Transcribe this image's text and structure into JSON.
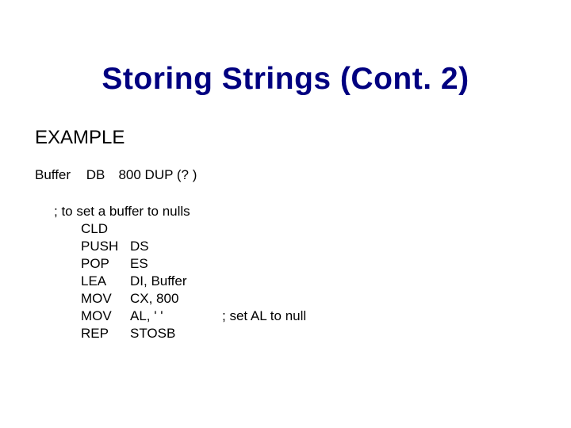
{
  "title": "Storing Strings (Cont. 2)",
  "subhead": "EXAMPLE",
  "decl": {
    "label": "Buffer",
    "directive": "DB",
    "value": "800 DUP (? )"
  },
  "code": {
    "comment_header": "; to set a buffer to nulls",
    "lines": [
      {
        "mnemonic": "CLD",
        "args": "",
        "comment": ""
      },
      {
        "mnemonic": "PUSH",
        "args": "DS",
        "comment": ""
      },
      {
        "mnemonic": "POP",
        "args": "ES",
        "comment": ""
      },
      {
        "mnemonic": "LEA",
        "args": "DI, Buffer",
        "comment": ""
      },
      {
        "mnemonic": "MOV",
        "args": "CX, 800",
        "comment": ""
      },
      {
        "mnemonic": "MOV",
        "args": "AL, ' '",
        "comment": "; set AL to null"
      },
      {
        "mnemonic": "REP",
        "args": "STOSB",
        "comment": ""
      }
    ]
  }
}
